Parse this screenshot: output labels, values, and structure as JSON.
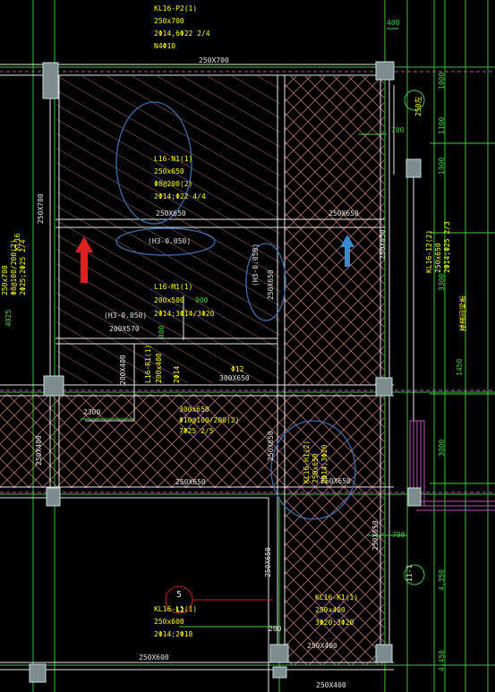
{
  "colors": {
    "background": "#000000",
    "beam": "#e6e6e6",
    "hatch": "#b06a6a",
    "column_fill": "#7f8c8f",
    "column_edge": "#c0e0e0",
    "axis_green": "#32c832",
    "axis_red": "#d02020",
    "annotation_yellow": "#ffff00",
    "dimension_green": "#40d040",
    "cloud_blue": "#3a6fb0",
    "arrow_red": "#e02020",
    "arrow_blue": "#3a8ad0",
    "magenta": "#c050c0"
  },
  "labels": {
    "kl16_p2": "KL16-P2(1)",
    "kl16_p2_size": "250x700",
    "kl16_p2_bars": "2Φ14,6Φ22 2/4",
    "kl16_p2_n": "N4Φ10",
    "dim_400_top": "400",
    "beam_250x700": "250X700",
    "dim_1000": "1000",
    "dim_1100": "1100",
    "note_250": "250左",
    "dim_700_a": "700",
    "dim_1900": "1900",
    "l16_n1": "L16-N1(1)",
    "l16_n1_size": "250x650",
    "l16_n1_stirrup": "Φ8@200(2)",
    "l16_n1_bars": "2Φ14;Φ22 4/4",
    "beam_250x650_a": "250X650",
    "beam_250x650_b": "250X650",
    "elev_1": "(H3-0.050)",
    "elev_2": "(H3-0.050)",
    "beam_250x650_v": "250X650",
    "kl16_12": "KL16-12(2)",
    "kl16_12_size": "250x650",
    "kl16_12_bars": "2Φ14;Φ25 2/3",
    "beam_250x700_left": "250X700",
    "beam_250x650_right": "250X650",
    "dim_3300": "3300",
    "stair_note": "楼梯间梁板",
    "left_note_1": "KL16",
    "left_note_2": "250x700",
    "left_note_3": "Φ8@100/200(2)",
    "left_note_4": "2Φ25;2Φ25 2/4",
    "dim_4025": "4025",
    "l16_m1": "L16-M1(1)",
    "l16_m1_size": "200x500",
    "l16_m1_bars": "2Φ14;3Φ14/3Φ20",
    "elev_3": "(H3-0.050)",
    "beam_200x570": "200X570",
    "dim_900": "900",
    "dim_400_mid": "400",
    "dim_1450": "1450",
    "beam_200x400": "200X400",
    "l16_r1": "L16-R1(1)",
    "l16_r1_size": "200x400",
    "l16_r1_bars": "2Φ14",
    "beam_300x650": "300X650",
    "r_note": "Φ12",
    "dim_2300": "2300",
    "kl_300": "300x650",
    "kl_300_stir": "Φ10@100/200(2)",
    "kl_300_bars": "7Φ25 2/5",
    "beam_250x400_left": "250X400",
    "beam_250x650_mid": "250X650",
    "beam_250x650_v2": "250X650",
    "kl16_h1": "KL16-H1(2)",
    "kl16_h1_size": "250x650",
    "kl16_h1_bars": "2Φ14;3Φ20",
    "beam_250x650_c": "250X650",
    "dim_3000": "3000",
    "beam_250x650_bottom": "250X650",
    "dim_700_b": "700",
    "beam_250x650_v3": "250X650",
    "axis_5": "5",
    "axis_11": "11-1",
    "axis_12": "12",
    "kl16_l1": "KL16-L1(1)",
    "kl16_l1_size": "250x600",
    "kl16_l1_bars": "2Φ14;2Φ18",
    "dim_4350": "4,350",
    "kl16_k1": "KL16-K1(1)",
    "kl16_k1_size": "250x400",
    "kl16_k1_bars": "3Φ20;3Φ20",
    "dim_200": "200",
    "beam_250x400_b": "250X400",
    "beam_250x600": "250X600",
    "dim_4450": "4,450",
    "beam_250x400_bottom": "250X400"
  }
}
